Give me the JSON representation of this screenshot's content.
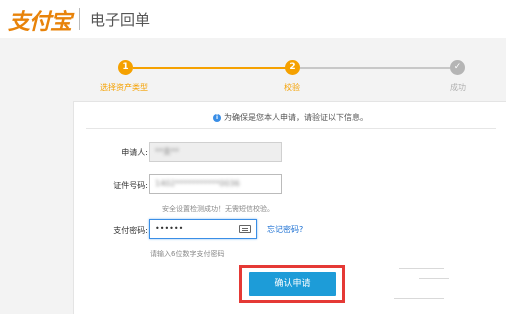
{
  "header": {
    "logo_text": "支付宝",
    "title": "电子回单"
  },
  "steps": [
    {
      "number": "1",
      "label": "选择资产类型",
      "state": "done",
      "color": "#f5a100"
    },
    {
      "number": "2",
      "label": "校验",
      "state": "current",
      "color": "#f5a100"
    },
    {
      "number": "",
      "label": "成功",
      "state": "pending",
      "color": "#b5b5b5"
    }
  ],
  "notice": {
    "icon": "info-icon",
    "text": "为确保是您本人申请，请验证以下信息。"
  },
  "form": {
    "applicant": {
      "label": "申请人:",
      "value": "**金**"
    },
    "id_number": {
      "label": "证件号码:",
      "value": "1402***********0036",
      "hint": "安全设置检测成功！无需短信校验。"
    },
    "pay_password": {
      "label": "支付密码:",
      "value": "••••••",
      "forgot_link": "忘记密码?",
      "hint": "请输入6位数字支付密码"
    }
  },
  "submit": {
    "label": "确认申请",
    "highlight_color": "#e53935"
  },
  "colors": {
    "accent_orange": "#f5a100",
    "button_blue": "#1d9cd8",
    "link_blue": "#1a6fd3"
  }
}
